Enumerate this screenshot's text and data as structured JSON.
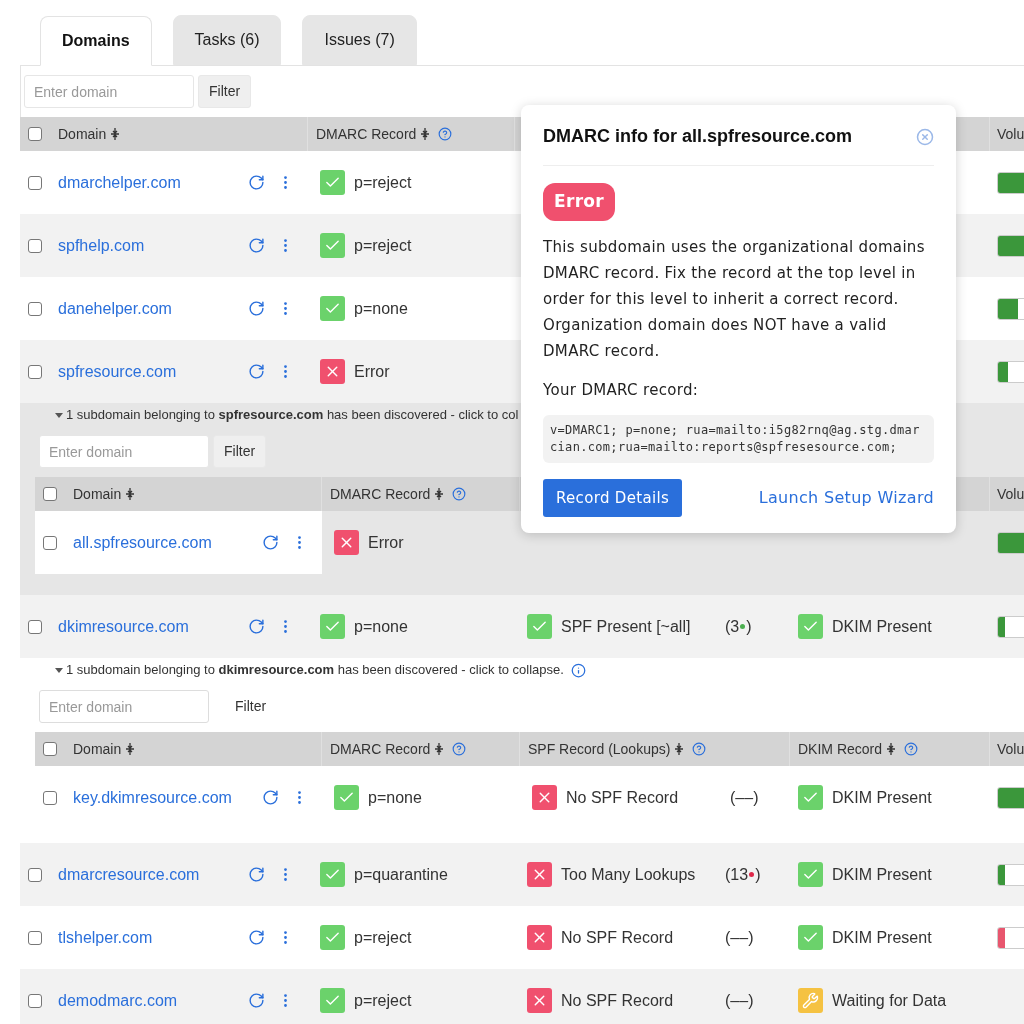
{
  "tabs": [
    {
      "label": "Domains",
      "selected": true
    },
    {
      "label": "Tasks (6)",
      "selected": false
    },
    {
      "label": "Issues (7)",
      "selected": false
    }
  ],
  "filter": {
    "placeholder": "Enter domain",
    "button": "Filter",
    "boxed": true
  },
  "table": {
    "all_checked": false,
    "columns": [
      {
        "kind": "domain",
        "label": "Domain",
        "sort": true,
        "help": false
      },
      {
        "kind": "dmarc",
        "label": "DMARC Record",
        "sort": true,
        "help": true
      },
      {
        "kind": "volume",
        "label": "Volu"
      }
    ],
    "items": [
      {
        "kind": "row",
        "domain": "dmarchelper.com",
        "checked": false,
        "shaded": false,
        "dmarc": {
          "kind": "ok",
          "text": "p=reject"
        },
        "volume": {
          "level": 1,
          "color": "#3b973b"
        }
      },
      {
        "kind": "row",
        "domain": "spfhelp.com",
        "checked": false,
        "shaded": true,
        "dmarc": {
          "kind": "ok",
          "text": "p=reject"
        },
        "volume": {
          "level": 1,
          "color": "#3b973b"
        }
      },
      {
        "kind": "row",
        "domain": "danehelper.com",
        "checked": false,
        "shaded": false,
        "dmarc": {
          "kind": "ok",
          "text": "p=none"
        },
        "volume": {
          "level": 0.3,
          "color": "#3b973b"
        }
      },
      {
        "kind": "row",
        "domain": "spfresource.com",
        "checked": false,
        "shaded": true,
        "dmarc": {
          "kind": "error",
          "text": "Error"
        },
        "volume": {
          "level": 0.15,
          "color": "#3b973b"
        }
      },
      {
        "kind": "expansion",
        "shaded": true,
        "note": "1 subdomain belonging to **spfresource.com** has been discovered - click to col",
        "info": false,
        "filter": {
          "placeholder": "Enter domain",
          "button": "Filter",
          "boxed": true
        },
        "table": {
          "all_checked": false,
          "columns": [
            {
              "kind": "domain",
              "label": "Domain",
              "sort": true,
              "help": false
            },
            {
              "kind": "dmarc",
              "label": "DMARC Record",
              "sort": true,
              "help": true
            },
            {
              "kind": "volume",
              "label": "Volu"
            }
          ],
          "rows": [
            {
              "domain": "all.spfresource.com",
              "checked": false,
              "dmarc": {
                "kind": "error",
                "text": "Error"
              },
              "volume": {
                "level": 1,
                "color": "#3b973b"
              }
            }
          ]
        }
      },
      {
        "kind": "row",
        "domain": "dkimresource.com",
        "checked": false,
        "shaded": true,
        "dmarc": {
          "kind": "ok",
          "text": "p=none"
        },
        "spf": {
          "kind": "ok",
          "text": "SPF Present [~all]"
        },
        "lookups": {
          "text": "(3",
          "color": "#4caf50",
          "end": ")"
        },
        "dkim": {
          "kind": "ok",
          "text": "DKIM Present"
        },
        "volume": {
          "level": 0.1,
          "color": "#3b973b"
        }
      },
      {
        "kind": "expansion",
        "shaded": false,
        "note": "1 subdomain belonging to **dkimresource.com** has been discovered - click to collapse.",
        "info": true,
        "filter": {
          "placeholder": "Enter domain",
          "button": "Filter",
          "boxed": false
        },
        "table": {
          "all_checked": false,
          "columns": [
            {
              "kind": "domain",
              "label": "Domain",
              "sort": true,
              "help": false
            },
            {
              "kind": "dmarc",
              "label": "DMARC Record",
              "sort": true,
              "help": true
            },
            {
              "kind": "spf",
              "label": "SPF Record (Lookups)",
              "sort": true,
              "help": true
            },
            {
              "kind": "dkim",
              "label": "DKIM Record",
              "sort": true,
              "help": true
            },
            {
              "kind": "volume",
              "label": "Volu"
            }
          ],
          "rows": [
            {
              "domain": "key.dkimresource.com",
              "checked": false,
              "dmarc": {
                "kind": "ok",
                "text": "p=none"
              },
              "spf": {
                "kind": "error",
                "text": "No SPF Record"
              },
              "lookups": {
                "text": "(––)"
              },
              "dkim": {
                "kind": "ok",
                "text": "DKIM Present"
              },
              "volume": {
                "level": 1,
                "color": "#3b973b"
              }
            }
          ]
        }
      },
      {
        "kind": "row",
        "domain": "dmarcresource.com",
        "checked": false,
        "shaded": true,
        "dmarc": {
          "kind": "ok",
          "text": "p=quarantine"
        },
        "spf": {
          "kind": "error",
          "text": "Too Many Lookups"
        },
        "lookups": {
          "text": "(13",
          "color": "#e0294a",
          "end": ")"
        },
        "dkim": {
          "kind": "ok",
          "text": "DKIM Present"
        },
        "volume": {
          "level": 0.1,
          "color": "#3b973b"
        }
      },
      {
        "kind": "row",
        "domain": "tlshelper.com",
        "checked": false,
        "shaded": false,
        "dmarc": {
          "kind": "ok",
          "text": "p=reject"
        },
        "spf": {
          "kind": "error",
          "text": "No SPF Record"
        },
        "lookups": {
          "text": "(––)"
        },
        "dkim": {
          "kind": "ok",
          "text": "DKIM Present"
        },
        "volume": {
          "level": 0.1,
          "color": "#e8566e"
        }
      },
      {
        "kind": "row",
        "domain": "demodmarc.com",
        "checked": false,
        "shaded": true,
        "dmarc": {
          "kind": "ok",
          "text": "p=reject"
        },
        "spf": {
          "kind": "error",
          "text": "No SPF Record"
        },
        "lookups": {
          "text": "(––)"
        },
        "dkim": {
          "kind": "waiting",
          "text": "Waiting for Data"
        }
      }
    ]
  },
  "popover": {
    "title": "DMARC info for all.spfresource.com",
    "badge": "Error",
    "message": "This subdomain uses the organizational domains DMARC record. Fix the record at the top level in order for this level to inherit a correct record. Organization domain does NOT have a valid DMARC record.",
    "record_label": "Your DMARC record:",
    "record": "v=DMARC1; p=none; rua=mailto:i5g82rnq@ag.stg.dmarcian.com;rua=mailto:reports@spfresesource.com;",
    "primary_button": "Record Details",
    "link": "Launch Setup Wizard"
  }
}
